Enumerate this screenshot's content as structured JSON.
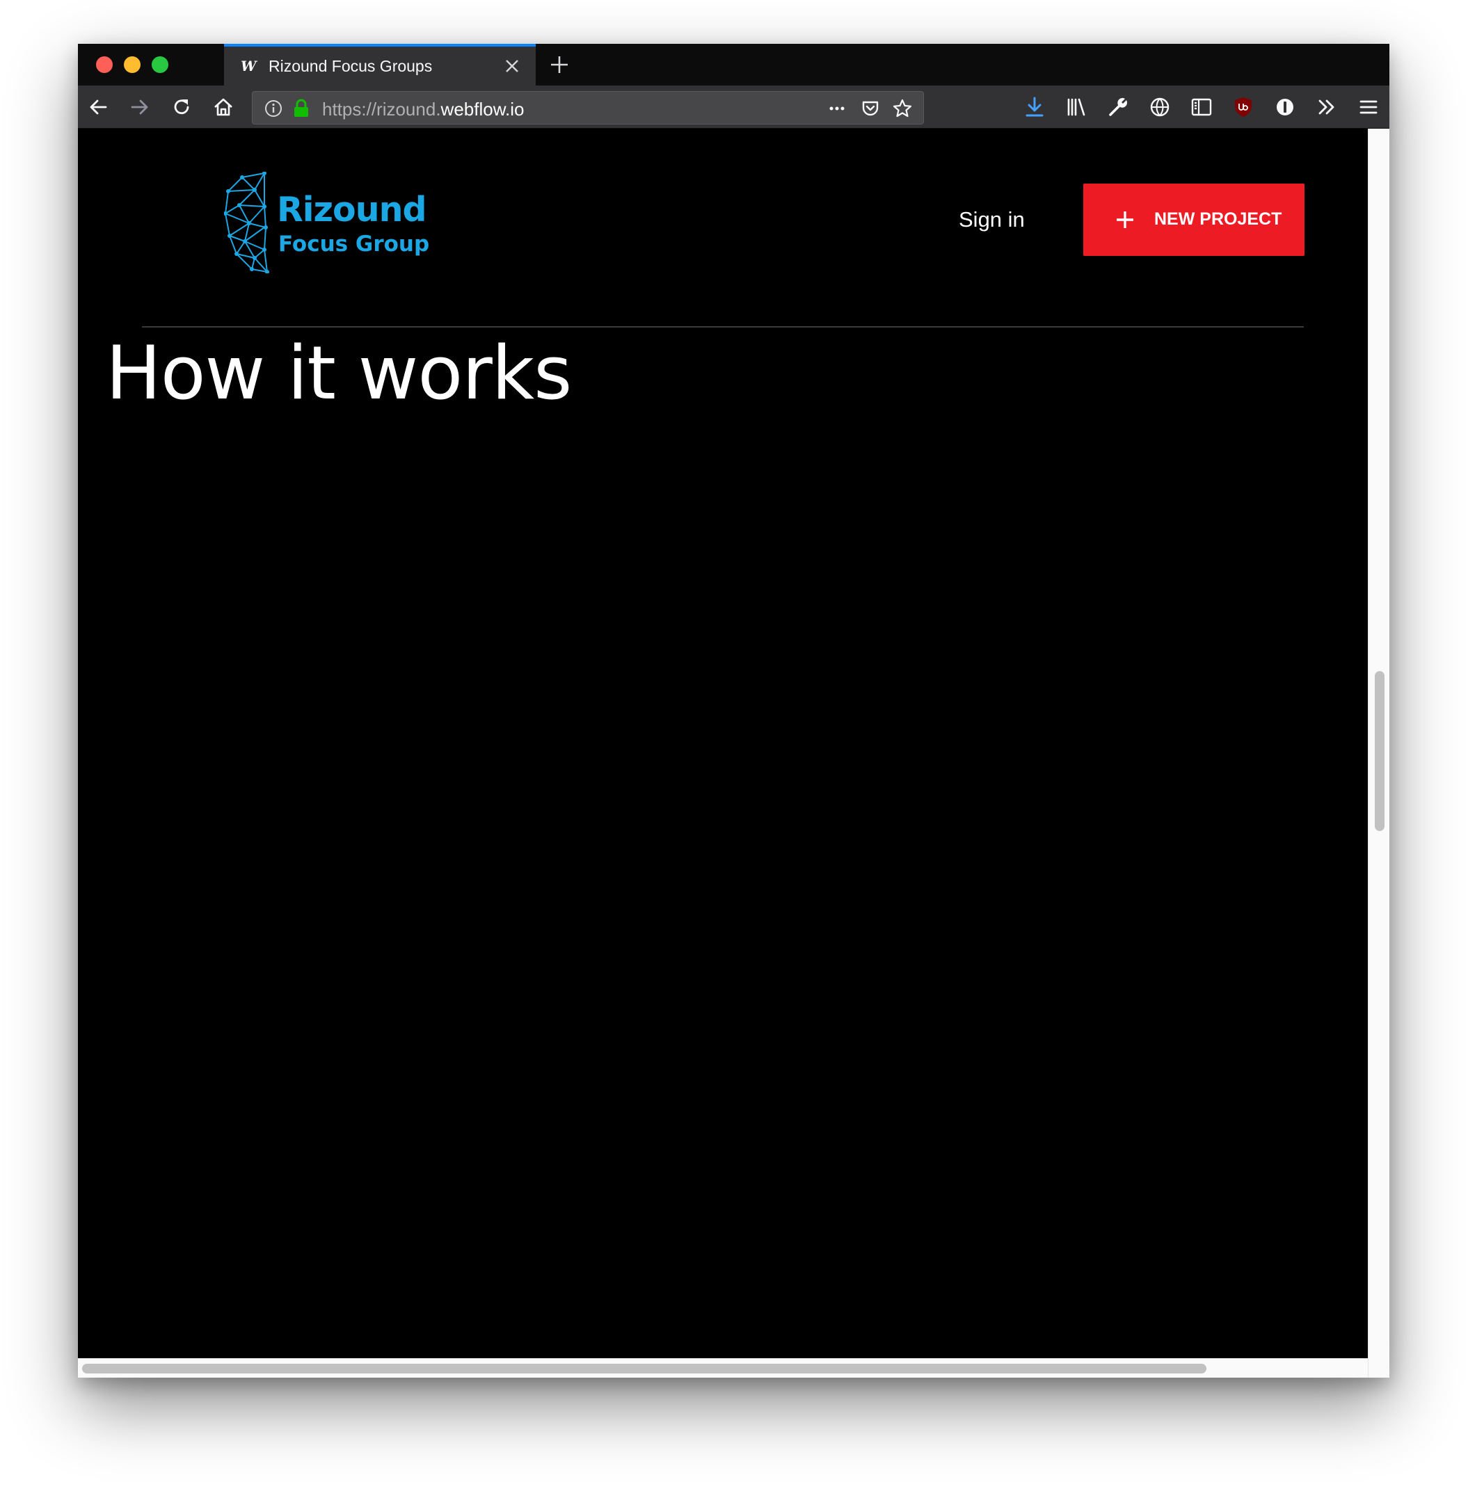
{
  "browser": {
    "tab": {
      "favicon_letter": "W",
      "title": "Rizound Focus Groups"
    },
    "url": {
      "prefix": "https://rizound.",
      "domain": "webflow.io"
    },
    "icons": {
      "back": "back-arrow-icon",
      "forward": "forward-arrow-icon",
      "reload": "reload-icon",
      "home": "home-icon",
      "info": "info-icon",
      "lock": "lock-icon",
      "more": "more-dots-icon",
      "pocket": "pocket-icon",
      "bookmark": "bookmark-star-icon",
      "download": "download-icon",
      "library": "library-icon",
      "tools": "wrench-icon",
      "translate": "globe-icon",
      "sidebar": "sidebar-icon",
      "ublock": "ublock-icon",
      "password": "password-manager-icon",
      "overflow": "overflow-chevrons-icon",
      "menu": "hamburger-menu-icon"
    },
    "accent_color": "#0a84ff"
  },
  "site": {
    "logo": {
      "line1": "Rizound",
      "line2": "Focus Group",
      "color": "#1ba7e4"
    },
    "nav": {
      "signin_label": "Sign in",
      "cta_label": "NEW PROJECT",
      "cta_color": "#ed1c24"
    },
    "main": {
      "heading": "How it works"
    },
    "background": "#000000"
  }
}
